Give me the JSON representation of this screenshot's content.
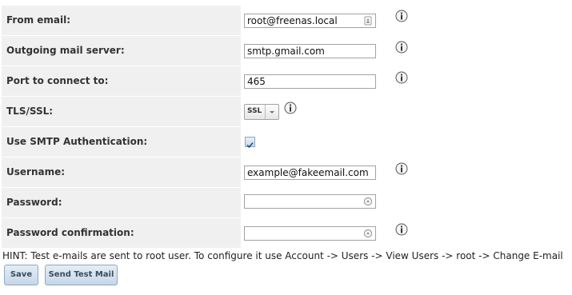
{
  "form": {
    "from_email": {
      "label": "From email:",
      "value": "root@freenas.local"
    },
    "outgoing_server": {
      "label": "Outgoing mail server:",
      "value": "smtp.gmail.com"
    },
    "port": {
      "label": "Port to connect to:",
      "value": "465"
    },
    "tls_ssl": {
      "label": "TLS/SSL:",
      "selected": "SSL"
    },
    "smtp_auth": {
      "label": "Use SMTP Authentication:",
      "checked": true
    },
    "username": {
      "label": "Username:",
      "value": "example@fakeemail.com"
    },
    "password": {
      "label": "Password:",
      "value": ""
    },
    "password_confirm": {
      "label": "Password confirmation:",
      "value": ""
    }
  },
  "hint": "HINT: Test e-mails are sent to root user. To configure it use Account -> Users -> View Users -> root -> Change E-mail",
  "buttons": {
    "save": "Save",
    "send_test": "Send Test Mail"
  },
  "icons": {
    "info": "info-icon",
    "contact_card": "contact-card-icon",
    "key": "key-icon"
  },
  "colors": {
    "label_bg": "#f0f0f0",
    "button_bg": "#d3e1ef",
    "button_border": "#8fa8c0"
  }
}
